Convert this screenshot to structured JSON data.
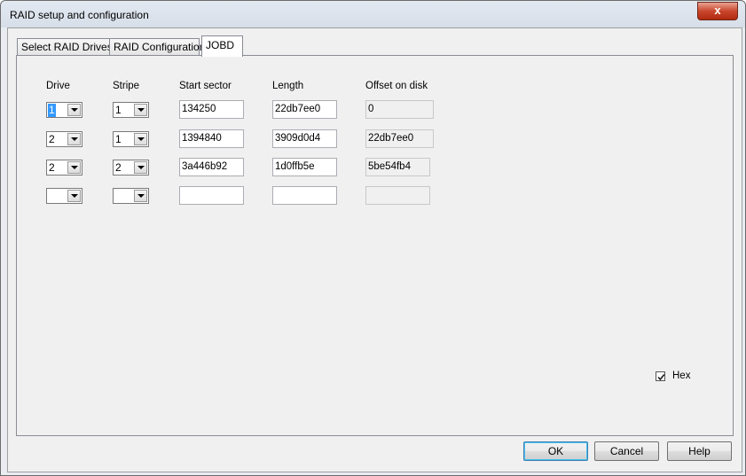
{
  "window": {
    "title": "RAID setup and configuration",
    "close_glyph": "x"
  },
  "tabs": [
    {
      "label": "Select RAID Drives",
      "active": false
    },
    {
      "label": "RAID Configuration",
      "active": false
    },
    {
      "label": "JOBD",
      "active": true
    }
  ],
  "jobd": {
    "headers": {
      "drive": "Drive",
      "stripe": "Stripe",
      "start_sector": "Start sector",
      "length": "Length",
      "offset": "Offset on disk"
    },
    "rows": [
      {
        "drive": "1",
        "stripe": "1",
        "start_sector": "134250",
        "length": "22db7ee0",
        "offset": "0"
      },
      {
        "drive": "2",
        "stripe": "1",
        "start_sector": "1394840",
        "length": "3909d0d4",
        "offset": "22db7ee0"
      },
      {
        "drive": "2",
        "stripe": "2",
        "start_sector": "3a446b92",
        "length": "1d0ffb5e",
        "offset": "5be54fb4"
      },
      {
        "drive": "",
        "stripe": "",
        "start_sector": "",
        "length": "",
        "offset": ""
      }
    ],
    "hex": {
      "label": "Hex",
      "checked": true
    }
  },
  "buttons": {
    "ok": "OK",
    "cancel": "Cancel",
    "help": "Help"
  },
  "colors": {
    "selection": "#3399ff",
    "close_button": "#c9462c"
  }
}
